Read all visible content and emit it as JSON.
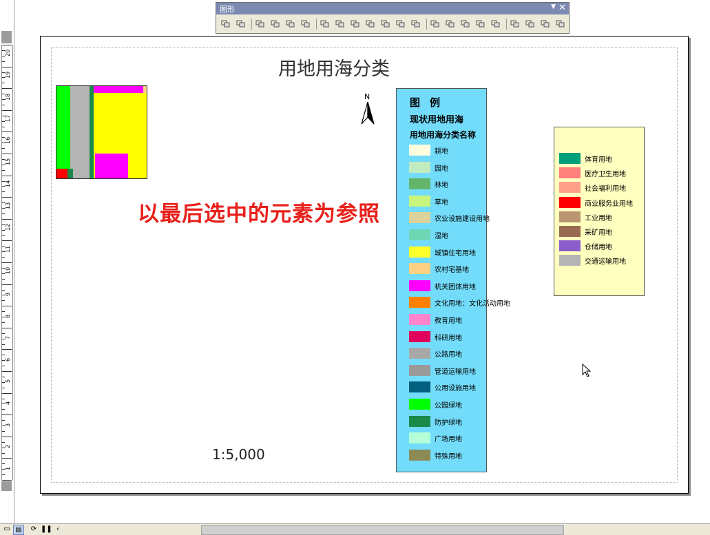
{
  "toolbar": {
    "title": "图形",
    "buttons": [
      "select-elements",
      "select-elements-2",
      "bring-to-front",
      "send-to-back",
      "bring-forward",
      "send-backward",
      "align-left",
      "align-left-2",
      "align-center",
      "align-right",
      "align-top",
      "align-middle",
      "align-bottom",
      "distribute-horizontally",
      "distribute-vertically",
      "make-same-size",
      "make-same-width",
      "make-same-height",
      "rotate",
      "flip",
      "flip-horizontal",
      "flip-vertical"
    ]
  },
  "map": {
    "title": "用地用海分类",
    "north_label": "N",
    "scale_text": "1:5,000",
    "annotation": "以最后选中的元素为参照"
  },
  "legend1": {
    "title": "图例",
    "subtitle1": "现状用地用海",
    "subtitle2": "用地用海分类名称",
    "items": [
      {
        "label": "耕地",
        "color": "#fffce0"
      },
      {
        "label": "园地",
        "color": "#c0ecc0"
      },
      {
        "label": "林地",
        "color": "#63b56a"
      },
      {
        "label": "草地",
        "color": "#c8f57c"
      },
      {
        "label": "农业设施建设用地",
        "color": "#dcd39c"
      },
      {
        "label": "湿地",
        "color": "#6dd6b5"
      },
      {
        "label": "城镇住宅用地",
        "color": "#ffff2a"
      },
      {
        "label": "农村宅基地",
        "color": "#ffd184"
      },
      {
        "label": "机关团体用地",
        "color": "#ff00ff"
      },
      {
        "label": "文化用地：文化活动用地",
        "color": "#ff8000"
      },
      {
        "label": "教育用地",
        "color": "#ff84cc"
      },
      {
        "label": "科研用地",
        "color": "#e0005c"
      },
      {
        "label": "公路用地",
        "color": "#a8a8a8"
      },
      {
        "label": "管道运输用地",
        "color": "#9a9a9a"
      },
      {
        "label": "公用设施用地",
        "color": "#00607e"
      },
      {
        "label": "公园绿地",
        "color": "#00ff00"
      },
      {
        "label": "防护绿地",
        "color": "#1a8a4a"
      },
      {
        "label": "广场用地",
        "color": "#b4ffd8"
      },
      {
        "label": "特殊用地",
        "color": "#8c8a55"
      }
    ]
  },
  "legend2": {
    "items": [
      {
        "label": "体育用地",
        "color": "#00a07a"
      },
      {
        "label": "医疗卫生用地",
        "color": "#ff7f7c"
      },
      {
        "label": "社会福利用地",
        "color": "#ffa08a"
      },
      {
        "label": "商业服务业用地",
        "color": "#ff0000"
      },
      {
        "label": "工业用地",
        "color": "#bb9470"
      },
      {
        "label": "采矿用地",
        "color": "#9a6a50"
      },
      {
        "label": "仓储用地",
        "color": "#8a5ccc"
      },
      {
        "label": "交通运输用地",
        "color": "#b4b4b4"
      }
    ]
  },
  "ruler": {
    "labels": [
      "20",
      "19",
      "18",
      "17",
      "16",
      "15",
      "14",
      "13",
      "12",
      "11",
      "10",
      "9",
      "8",
      "7",
      "6",
      "5",
      "4",
      "3",
      "2",
      "1"
    ]
  }
}
